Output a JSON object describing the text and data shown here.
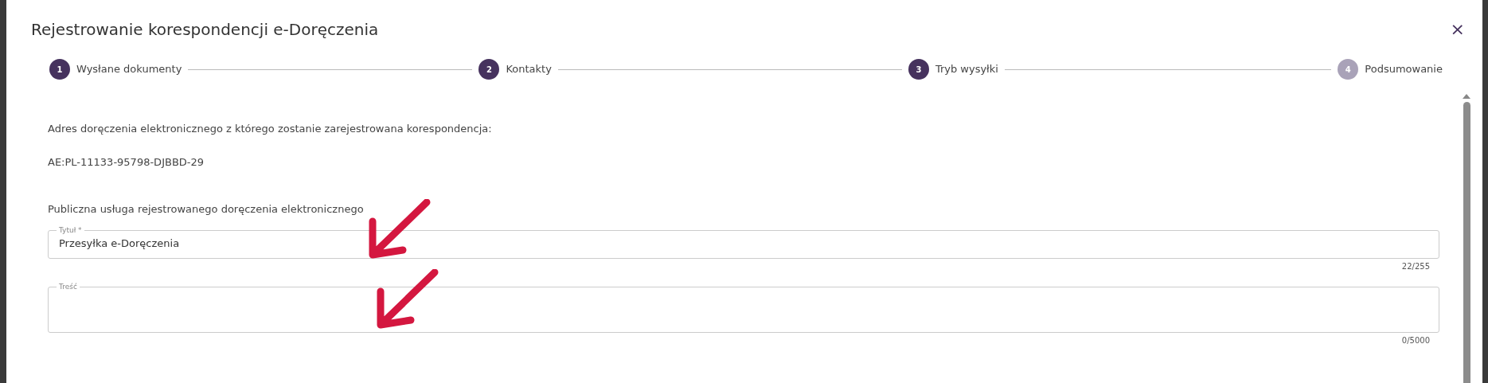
{
  "dialog": {
    "title": "Rejestrowanie korespondencji e-Doręczenia",
    "close": "×"
  },
  "steps": [
    {
      "number": "1",
      "label": "Wysłane dokumenty",
      "active": true
    },
    {
      "number": "2",
      "label": "Kontakty",
      "active": true
    },
    {
      "number": "3",
      "label": "Tryb wysyłki",
      "active": true
    },
    {
      "number": "4",
      "label": "Podsumowanie",
      "active": false
    }
  ],
  "address_label": "Adres doręczenia elektronicznego z którego zostanie zarejestrowana korespondencja:",
  "address": "AE:PL-11133-95798-DJBBD-29",
  "service_label": "Publiczna usługa rejestrowanego doręczenia elektronicznego",
  "fields": [
    {
      "kind": "input",
      "label": "Tytuł *",
      "value": "Przesyłka e-Doręczenia",
      "counter": "22/255"
    },
    {
      "kind": "textarea",
      "label": "Treść",
      "counter": "0/5000"
    }
  ],
  "annotations": [
    {
      "kind": "arrow"
    },
    {
      "kind": "arrow"
    }
  ]
}
